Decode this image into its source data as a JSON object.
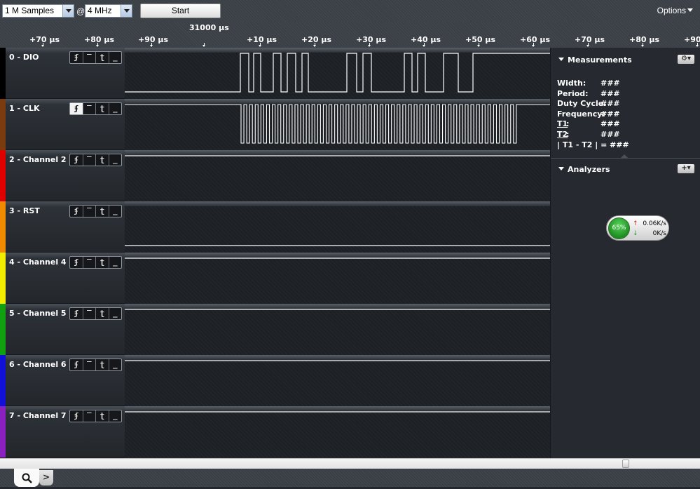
{
  "toolbar": {
    "samples": "1 M Samples",
    "at": "@",
    "rate": "4 MHz",
    "start_label": "Start",
    "options_label": "Options"
  },
  "ruler": {
    "center_time": "31000 µs",
    "ticks": [
      "+70 µs",
      "+80 µs",
      "+90 µs",
      "+10 µs",
      "+20 µs",
      "+30 µs",
      "+40 µs",
      "+50 µs",
      "+60 µs",
      "+70 µs",
      "+80 µs",
      "+90 µs"
    ]
  },
  "channels": [
    {
      "name": "0 - DIO",
      "color": "#000000"
    },
    {
      "name": "1 - CLK",
      "color": "#7a3b0f"
    },
    {
      "name": "2 - Channel 2",
      "color": "#e00000"
    },
    {
      "name": "3 - RST",
      "color": "#f08a00"
    },
    {
      "name": "4 - Channel 4",
      "color": "#f2ec00"
    },
    {
      "name": "5 - Channel 5",
      "color": "#10a010"
    },
    {
      "name": "6 - Channel 6",
      "color": "#1010d8"
    },
    {
      "name": "7 - Channel 7",
      "color": "#8a20c0"
    }
  ],
  "trigger_buttons": {
    "rising": "ʄ",
    "high": "‾",
    "falling": "ʈ",
    "low": "_"
  },
  "measurements": {
    "title": "Measurements",
    "rows": [
      {
        "key": "Width:",
        "value": "###"
      },
      {
        "key": "Period:",
        "value": "###"
      },
      {
        "key": "Duty Cycle:",
        "value": "###"
      },
      {
        "key": "Frequency:",
        "value": "###"
      },
      {
        "key": "T1",
        "value": "###"
      },
      {
        "key": "T2",
        "value": "###"
      },
      {
        "key": "| T1 - T2 | =",
        "value": "###"
      }
    ]
  },
  "analyzers": {
    "title": "Analyzers",
    "add_label": "+"
  },
  "status": {
    "cpu": "65%",
    "upload": "0.06K/s",
    "download": "0K/s"
  },
  "tabs": {
    "search_icon": "search-icon",
    "more_label": ">"
  }
}
